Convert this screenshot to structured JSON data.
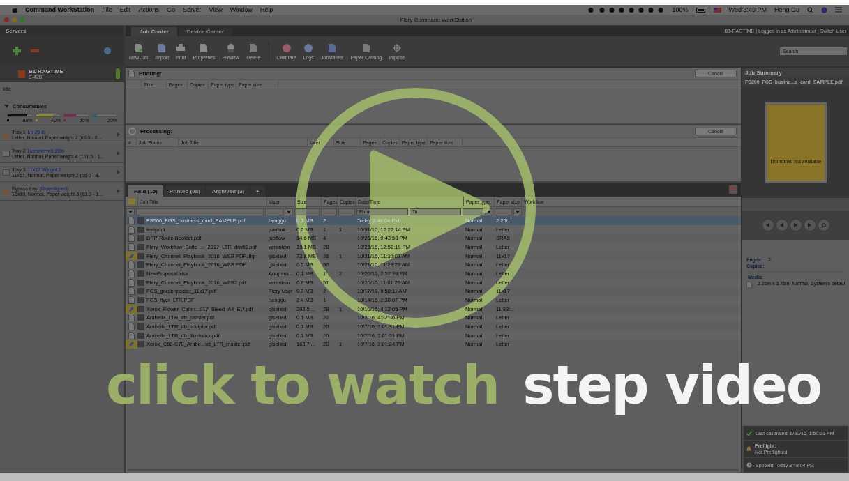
{
  "menubar": {
    "app": "Command WorkStation",
    "menus": [
      "File",
      "Edit",
      "Actions",
      "Go",
      "Server",
      "View",
      "Window",
      "Help"
    ],
    "battery": "100%",
    "clock": "Wed 3:49 PM",
    "user": "Heng Gu"
  },
  "window": {
    "title": "Fiery Command WorkStation"
  },
  "sidebar": {
    "title": "Servers",
    "server": {
      "name": "B1-RAGTIME",
      "model": "E-42B",
      "status": "Idle"
    },
    "consumables": {
      "title": "Consumables",
      "expanded": true,
      "items": [
        {
          "color": "#111111",
          "level": 0.8,
          "reading": "80%"
        },
        {
          "color": "#8f8a2c",
          "level": 0.7,
          "reading": "70%"
        },
        {
          "color": "#7d2450",
          "level": 0.5,
          "reading": "50%"
        },
        {
          "color": "#1d6a80",
          "level": 0.2,
          "reading": "20%"
        }
      ]
    },
    "trays": [
      {
        "kind": "warning",
        "name": "Tray 1",
        "media": "Ltr 20 lb",
        "detail": "Letter, Normal, Paper weight 2 (66.0 - 8..."
      },
      {
        "kind": "normal",
        "name": "Tray 2",
        "media": "Hammermill 28lb",
        "detail": "Letter, Normal, Paper weight 4 (101.0 - 1..."
      },
      {
        "kind": "normal",
        "name": "Tray 3",
        "media": "11x17 Weight 2",
        "detail": "11x17, Normal, Paper weight 2 (66.0 - 8..."
      },
      {
        "kind": "warning",
        "name": "Bypass tray",
        "media": "(Unassigned)",
        "detail": "13x19, Normal, Paper weight 3 (81.0 - 1..."
      }
    ]
  },
  "top_tabs": [
    {
      "label": "Job Center",
      "selected": true
    },
    {
      "label": "Device Center",
      "selected": false
    }
  ],
  "login_info": "B1-RAGTIME | Logged in as Administrator | Switch User",
  "toolbar": [
    {
      "kind": "newjob",
      "label": "New Job"
    },
    {
      "kind": "import",
      "label": "Import"
    },
    {
      "kind": "print",
      "label": "Print"
    },
    {
      "kind": "properties",
      "label": "Properties"
    },
    {
      "kind": "preview",
      "label": "Preview"
    },
    {
      "kind": "delete",
      "label": "Delete"
    },
    {
      "kind": "calibrate",
      "label": "Calibrate"
    },
    {
      "kind": "logs",
      "label": "Logs"
    },
    {
      "kind": "jobmaster",
      "label": "JobMaster"
    },
    {
      "kind": "catalog",
      "label": "Paper Catalog"
    },
    {
      "kind": "impose",
      "label": "Impose"
    }
  ],
  "search": {
    "placeholder": "Search"
  },
  "printing": {
    "title": "Printing:",
    "button": "Cancel",
    "columns": [
      "Size",
      "Pages",
      "Copies",
      "Paper type",
      "Paper size"
    ]
  },
  "processing": {
    "title": "Processing:",
    "button": "Cancel",
    "columns": [
      "#",
      "Job Status",
      "Job Title",
      "User",
      "Size",
      "Pages",
      "Copies",
      "Paper type",
      "Paper size"
    ]
  },
  "job_tabs": [
    {
      "label": "Held (15)",
      "selected": true
    },
    {
      "label": "Printed (98)",
      "selected": false
    },
    {
      "label": "Archived (3)",
      "selected": false
    },
    {
      "label": "+",
      "selected": false
    }
  ],
  "table": {
    "columns": [
      "Job Title",
      "User",
      "Size",
      "Pages",
      "Copies",
      "Date/Time",
      "Paper type",
      "Paper size",
      "Workflow"
    ],
    "filter_from": {
      "placeholder": "From"
    },
    "filter_to": {
      "placeholder": "To"
    },
    "rows": [
      {
        "kind": "doc",
        "selected": true,
        "cells": [
          "FS200_FGS_business_card_SAMPLE.pdf",
          "henggu",
          "0.1 MB",
          "2",
          "",
          "Today 3:49:04 PM",
          "Normal",
          "2.25i..."
        ]
      },
      {
        "kind": "doc",
        "selected": false,
        "cells": [
          "testprint",
          "paulmic...",
          "0.2 MB",
          "1",
          "1",
          "10/31/16, 12:22:14 PM",
          "Normal",
          "Letter"
        ]
      },
      {
        "kind": "doc",
        "selected": false,
        "cells": [
          "DRP-Route-Booklet.pdf",
          "jobflow",
          "14.6 MB",
          "4",
          "",
          "10/26/16, 9:43:58 PM",
          "Normal",
          "SRA3"
        ]
      },
      {
        "kind": "doc",
        "selected": false,
        "cells": [
          "Fiery_Workflow_Suite_..._2017_LTR_draft3.pdf",
          "veronicm",
          "19.1 MB",
          "28",
          "",
          "10/25/16, 12:52:19 PM",
          "Normal",
          "Letter"
        ]
      },
      {
        "kind": "dbp",
        "selected": false,
        "cells": [
          "Fiery_Channel_Playbook_2016_WEB.PDF.dbp",
          "giselled",
          "73.8 MB",
          "26",
          "1",
          "10/21/16, 11:30:03 AM",
          "Normal",
          "11x17"
        ]
      },
      {
        "kind": "doc",
        "selected": false,
        "cells": [
          "Fiery_Channel_Playbook_2016_WEB.PDF",
          "giselled",
          "6.5 MB",
          "52",
          "",
          "10/21/16, 11:29:23 AM",
          "Normal",
          "Letter"
        ]
      },
      {
        "kind": "doc",
        "selected": false,
        "cells": [
          "NewProposal.xlsx",
          "Anupam...",
          "0.1 MB",
          "1",
          "2",
          "10/20/16, 2:52:39 PM",
          "Normal",
          "Letter"
        ]
      },
      {
        "kind": "doc",
        "selected": false,
        "cells": [
          "Fiery_Channel_Playbook_2016_WEB2.pdf",
          "veronicm",
          "6.8 MB",
          "51",
          "",
          "10/20/16, 11:01:29 AM",
          "Normal",
          "Letter"
        ]
      },
      {
        "kind": "doc",
        "selected": false,
        "cells": [
          "FGS_gardenposter_11x17.pdf",
          "Fiery User",
          "9.3 MB",
          "2",
          "",
          "10/17/16, 9:50:11 AM",
          "Normal",
          "11x17"
        ]
      },
      {
        "kind": "doc",
        "selected": false,
        "cells": [
          "FGS_flyer_LTR.PDF",
          "henggu",
          "2.4 MB",
          "1",
          "",
          "10/14/16, 2:30:07 PM",
          "Normal",
          "Letter"
        ]
      },
      {
        "kind": "dbp",
        "selected": false,
        "cells": [
          "Xerox_Flower_Calen...017_Bleed_A4_EU.pdf",
          "giselled",
          "292.5 ...",
          "28",
          "1",
          "10/10/16, 4:12:05 PM",
          "Normal",
          "11.93i..."
        ]
      },
      {
        "kind": "doc",
        "selected": false,
        "cells": [
          "Arabella_LTR_db_painter.pdf",
          "giselled",
          "0.1 MB",
          "20",
          "",
          "10/7/16, 4:32:36 PM",
          "Normal",
          "Letter"
        ]
      },
      {
        "kind": "doc",
        "selected": false,
        "cells": [
          "Arabella_LTR_db_sculptor.pdf",
          "giselled",
          "0.1 MB",
          "20",
          "",
          "10/7/16, 3:01:31 PM",
          "Normal",
          "Letter"
        ]
      },
      {
        "kind": "doc",
        "selected": false,
        "cells": [
          "Arabella_LTR_db_illustrator.pdf",
          "giselled",
          "0.1 MB",
          "20",
          "",
          "10/7/16, 3:01:31 PM",
          "Normal",
          "Letter"
        ]
      },
      {
        "kind": "dbp",
        "selected": false,
        "cells": [
          "Xerox_C60-C70_Arabe...let_LTR_master.pdf",
          "giselled",
          "163.7 ...",
          "20",
          "1",
          "10/7/16, 3:01:24 PM",
          "Normal",
          "Letter"
        ]
      }
    ]
  },
  "job_summary": {
    "title": "Job Summary",
    "file": "FS200_FGS_busine...s_card_SAMPLE.pdf",
    "thumbnail_text": "Thumbnail not available",
    "pages_label": "Pages:",
    "pages": "2",
    "copies_label": "Copies:",
    "media_label": "Media:",
    "media": "2.25in x 3.75in, Normal, System's defaul",
    "status": [
      {
        "kind": "check",
        "text": "Last calibrated: 8/30/16, 1:50:31 PM"
      },
      {
        "kind": "bell",
        "title": "Preflight:",
        "text": "Not Preflighted"
      },
      {
        "kind": "clock",
        "text": "Spooled Today 3:49:04 PM"
      }
    ]
  },
  "overlay": {
    "call": "click to watch",
    "subject": "step video"
  }
}
